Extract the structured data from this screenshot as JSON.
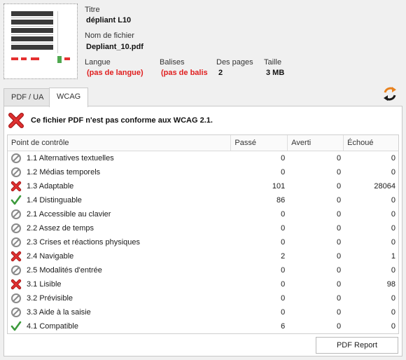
{
  "document": {
    "title_label": "Titre",
    "title_value": "dépliant L10",
    "filename_label": "Nom de fichier",
    "filename_value": "Depliant_10.pdf",
    "language_label": "Langue",
    "language_value": "(pas de langue)",
    "tags_label": "Balises",
    "tags_value": "(pas de balis",
    "pages_label": "Des pages",
    "pages_value": "2",
    "size_label": "Taille",
    "size_value": "3 MB"
  },
  "tabs": [
    {
      "label": "PDF / UA",
      "active": false
    },
    {
      "label": "WCAG",
      "active": true
    }
  ],
  "status": {
    "icon": "fail-cross-icon",
    "message": "Ce fichier PDF n'est pas conforme aux WCAG 2.1."
  },
  "table": {
    "columns": [
      "Point de contrôle",
      "Passé",
      "Averti",
      "Échoué"
    ],
    "rows": [
      {
        "status": "skip",
        "label": "1.1 Alternatives textuelles",
        "passed": "0",
        "warned": "0",
        "failed": "0"
      },
      {
        "status": "skip",
        "label": "1.2 Médias temporels",
        "passed": "0",
        "warned": "0",
        "failed": "0"
      },
      {
        "status": "fail",
        "label": "1.3 Adaptable",
        "passed": "101",
        "warned": "0",
        "failed": "28064"
      },
      {
        "status": "pass",
        "label": "1.4 Distinguable",
        "passed": "86",
        "warned": "0",
        "failed": "0"
      },
      {
        "status": "skip",
        "label": "2.1 Accessible au clavier",
        "passed": "0",
        "warned": "0",
        "failed": "0"
      },
      {
        "status": "skip",
        "label": "2.2 Assez de temps",
        "passed": "0",
        "warned": "0",
        "failed": "0"
      },
      {
        "status": "skip",
        "label": "2.3 Crises et réactions physiques",
        "passed": "0",
        "warned": "0",
        "failed": "0"
      },
      {
        "status": "fail",
        "label": "2.4 Navigable",
        "passed": "2",
        "warned": "0",
        "failed": "1"
      },
      {
        "status": "skip",
        "label": "2.5 Modalités d'entrée",
        "passed": "0",
        "warned": "0",
        "failed": "0"
      },
      {
        "status": "fail",
        "label": "3.1 Lisible",
        "passed": "0",
        "warned": "0",
        "failed": "98"
      },
      {
        "status": "skip",
        "label": "3.2 Prévisible",
        "passed": "0",
        "warned": "0",
        "failed": "0"
      },
      {
        "status": "skip",
        "label": "3.3 Aide à la saisie",
        "passed": "0",
        "warned": "0",
        "failed": "0"
      },
      {
        "status": "pass",
        "label": "4.1 Compatible",
        "passed": "6",
        "warned": "0",
        "failed": "0"
      }
    ]
  },
  "report_button": "PDF Report",
  "colors": {
    "error_red": "#e01e1e",
    "pass_green": "#3c9a3c",
    "neutral_grey": "#8a8a8a"
  }
}
